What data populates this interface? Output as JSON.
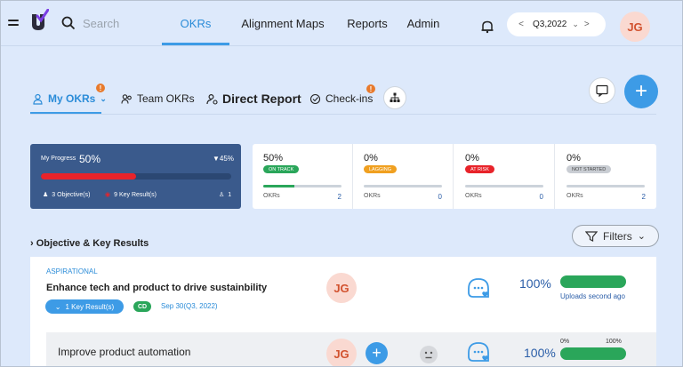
{
  "header": {
    "search_placeholder": "Search",
    "nav": [
      "OKRs",
      "Alignment Maps",
      "Reports",
      "Admin"
    ],
    "quarter": {
      "prev": "<",
      "label": "Q3,2022",
      "dropdown": "⌄",
      "next": ">"
    },
    "user_initials": "JG"
  },
  "tabs": {
    "my_okrs": "My OKRs",
    "team_okrs": "Team OKRs",
    "direct_report": "Direct Report",
    "check_ins": "Check-ins",
    "badge": "!"
  },
  "progress": {
    "label": "My Progress",
    "value": "50%",
    "delta": "▼45%",
    "fill_fraction": 0.5,
    "objectives": "3 Objective(s)",
    "key_results": "9 Key Result(s)",
    "contributors": "1"
  },
  "status_cards": [
    {
      "value": "50%",
      "status": "ON TRACK",
      "color": "#2aa65a",
      "progress_fraction": 0.4,
      "label": "OKRs",
      "count": "2"
    },
    {
      "value": "0%",
      "status": "LAGGING",
      "color": "#f0a020",
      "progress_fraction": 0,
      "label": "OKRs",
      "count": "0"
    },
    {
      "value": "0%",
      "status": "AT RISK",
      "color": "#e8232a",
      "progress_fraction": 0,
      "label": "OKRs",
      "count": "0"
    },
    {
      "value": "0%",
      "status": "NOT STARTED",
      "color": "#c9cdd3",
      "progress_fraction": 0,
      "label": "OKRs",
      "count": "2"
    }
  ],
  "section": {
    "title": "Objective & Key Results",
    "filters": "Filters"
  },
  "objective": {
    "type": "ASPIRATIONAL",
    "title": "Enhance tech and product to drive sustainbility",
    "key_results_label": "1 Key Result(s)",
    "badge": "CD",
    "due": "Sep 30(Q3, 2022)",
    "owner_initials": "JG",
    "progress": "100%",
    "progress_fraction": 1.0,
    "updated": "Uploads second ago"
  },
  "key_result": {
    "title": "Improve product automation",
    "owner_initials": "JG",
    "progress": "100%",
    "progress_fraction": 1.0,
    "range_low": "0%",
    "range_high": "100%"
  }
}
